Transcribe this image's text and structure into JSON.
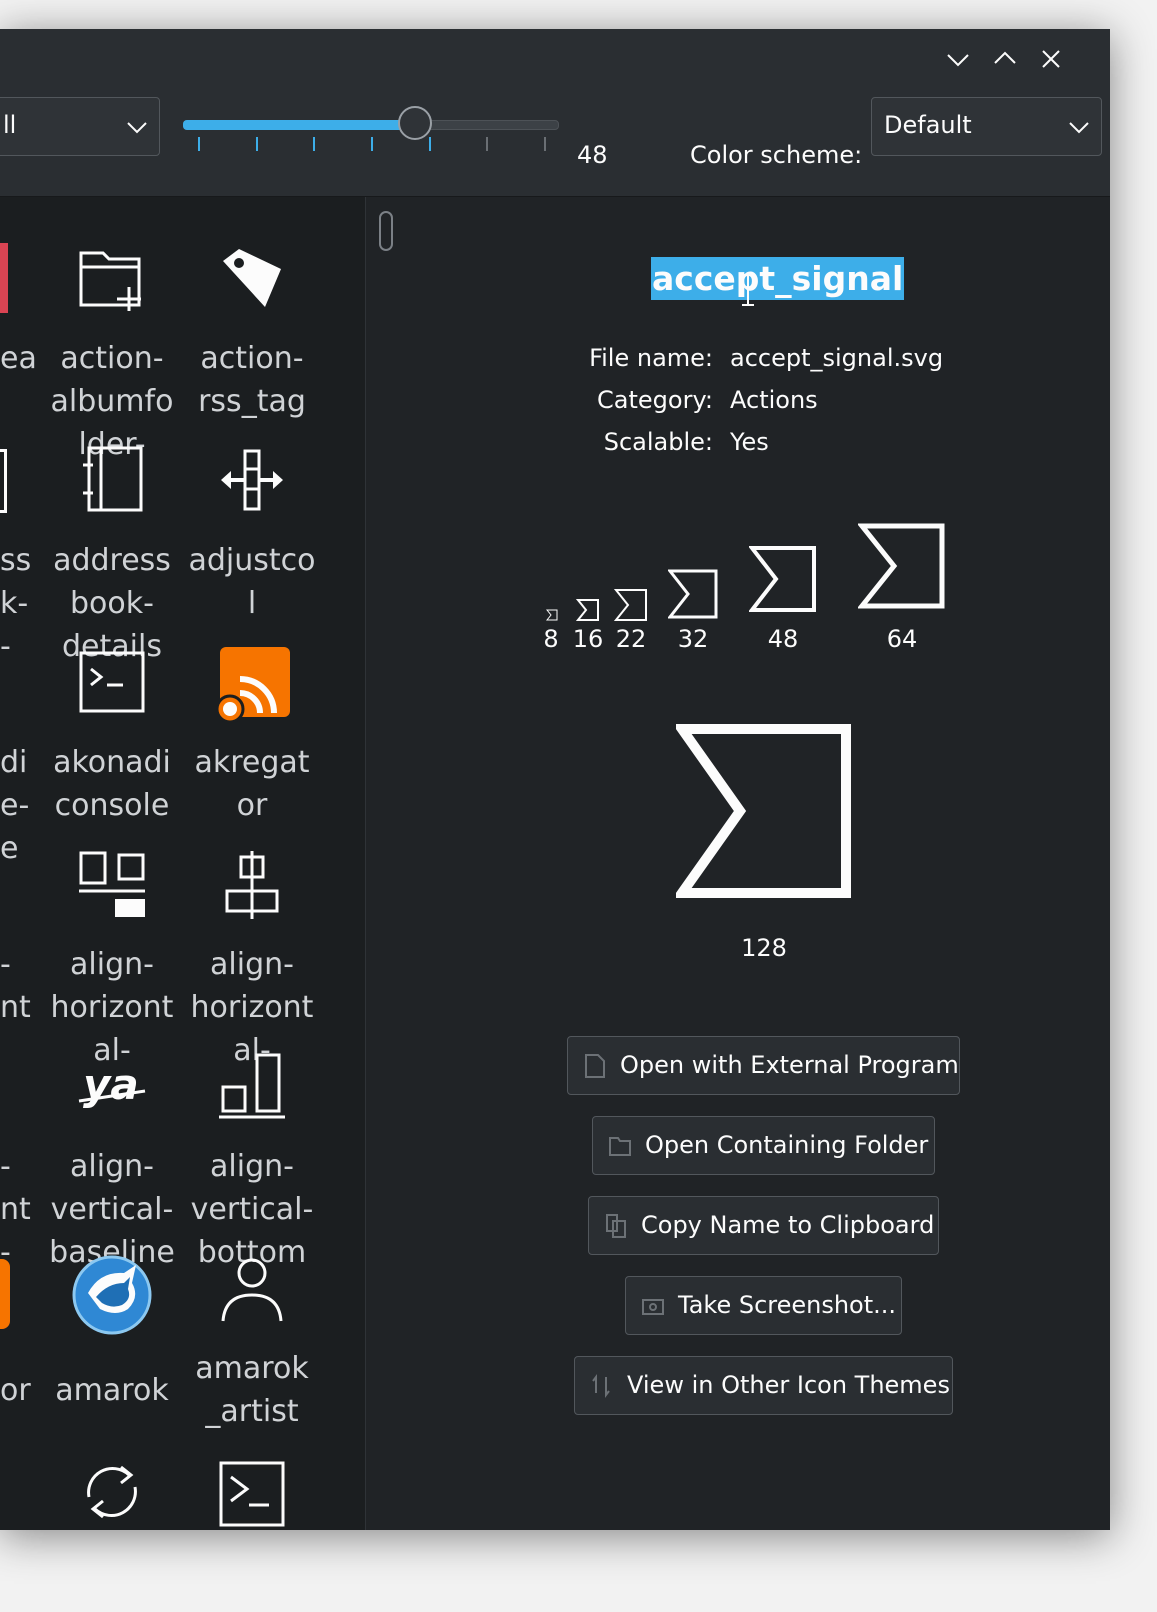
{
  "toolbar": {
    "context_combo_value": "ll",
    "size_value": "48",
    "slider_fraction": 0.62,
    "color_scheme_label": "Color scheme:",
    "color_scheme_value": "Default"
  },
  "icons": {
    "row1": [
      "action-\nalbumfo\nlder-",
      "action-\nrss_tag"
    ],
    "row2": [
      "address\nbook-\ndetails",
      "adjustco\nl"
    ],
    "row3": [
      "akonadi\nconsole",
      "akregat\nor"
    ],
    "row4": [
      "align-\nhorizont\nal-",
      "align-\nhorizont\nal-"
    ],
    "row5": [
      "align-\nvertical-\nbaseline",
      "align-\nvertical-\nbottom"
    ],
    "row6": [
      "amarok",
      "amarok\n_artist"
    ],
    "cut_left": [
      "ea",
      "ss\nk-\n-",
      "di\ne-\ne",
      "-\nnt",
      "-\nnt\n-",
      "or"
    ]
  },
  "details": {
    "icon_name": "accept_signal",
    "file_name_label": "File name:",
    "file_name": "accept_signal.svg",
    "category_label": "Category:",
    "category": "Actions",
    "scalable_label": "Scalable:",
    "scalable": "Yes",
    "sizes": [
      "8",
      "16",
      "22",
      "32",
      "48",
      "64"
    ],
    "large_size": "128",
    "buttons": {
      "open_external": "Open with External Program",
      "open_folder": "Open Containing Folder",
      "copy_name": "Copy Name to Clipboard",
      "screenshot": "Take Screenshot...",
      "other_themes": "View in Other Icon Themes"
    }
  },
  "colors": {
    "accent": "#3daee9",
    "window_bg": "#202326",
    "list_bg": "#1b1e20",
    "text": "#fcfcfc",
    "rss_orange": "#f67400"
  }
}
